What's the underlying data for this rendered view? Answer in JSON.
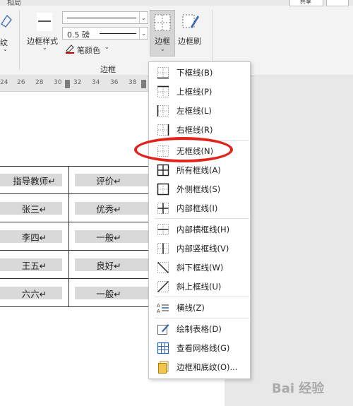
{
  "ribbon": {
    "partial_top_label": "相局",
    "partial_left_label": "纹",
    "border_style_label": "边框样式",
    "line_weight_value": "0.5 磅",
    "pen_color_label": "笔颜色",
    "group_label": "边框",
    "borders_button_label": "边框",
    "border_painter_label": "边框刷",
    "top_right_btn_label": "共享"
  },
  "ruler": {
    "ticks": [
      "24",
      "26",
      "28",
      "30",
      "32",
      "34",
      "36",
      "38"
    ]
  },
  "table": {
    "rows": [
      {
        "col1": "指导教师↵",
        "col2": "评价↵"
      },
      {
        "col1": "张三↵",
        "col2": "优秀↵"
      },
      {
        "col1": "李四↵",
        "col2": "一般↵"
      },
      {
        "col1": "王五↵",
        "col2": "良好↵"
      },
      {
        "col1": "六六↵",
        "col2": "一般↵"
      }
    ]
  },
  "menu": {
    "items": [
      {
        "label": "下框线(B)",
        "icon": "border-bottom-icon"
      },
      {
        "label": "上框线(P)",
        "icon": "border-top-icon"
      },
      {
        "label": "左框线(L)",
        "icon": "border-left-icon"
      },
      {
        "label": "右框线(R)",
        "icon": "border-right-icon"
      },
      {
        "label": "无框线(N)",
        "icon": "no-border-icon"
      },
      {
        "label": "所有框线(A)",
        "icon": "all-borders-icon"
      },
      {
        "label": "外侧框线(S)",
        "icon": "outside-borders-icon"
      },
      {
        "label": "内部框线(I)",
        "icon": "inside-borders-icon"
      },
      {
        "label": "内部横框线(H)",
        "icon": "inside-horizontal-border-icon"
      },
      {
        "label": "内部竖框线(V)",
        "icon": "inside-vertical-border-icon"
      },
      {
        "label": "斜下框线(W)",
        "icon": "diagonal-down-border-icon"
      },
      {
        "label": "斜上框线(U)",
        "icon": "diagonal-up-border-icon"
      },
      {
        "label": "横线(Z)",
        "icon": "horizontal-line-icon"
      },
      {
        "label": "绘制表格(D)",
        "icon": "draw-table-icon"
      },
      {
        "label": "查看网格线(G)",
        "icon": "view-gridlines-icon"
      },
      {
        "label": "边框和底纹(O)...",
        "icon": "borders-shading-icon"
      }
    ]
  },
  "watermark": "Bai 经验"
}
